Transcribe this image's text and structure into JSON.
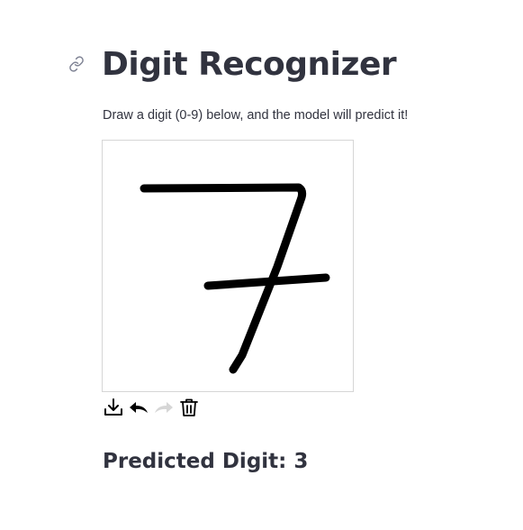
{
  "page": {
    "title": "Digit Recognizer",
    "anchor_icon": "link-icon",
    "description": "Draw a digit (0-9) below, and the model will predict it!"
  },
  "canvas": {
    "background": "#ffffff",
    "stroke_color": "#000000"
  },
  "toolbar": {
    "buttons": [
      {
        "name": "download",
        "icon": "download-icon",
        "enabled": true
      },
      {
        "name": "undo",
        "icon": "undo-icon",
        "enabled": true
      },
      {
        "name": "redo",
        "icon": "redo-icon",
        "enabled": false
      },
      {
        "name": "clear",
        "icon": "trash-icon",
        "enabled": true
      }
    ]
  },
  "result": {
    "prediction_text": "Predicted Digit: 3"
  }
}
